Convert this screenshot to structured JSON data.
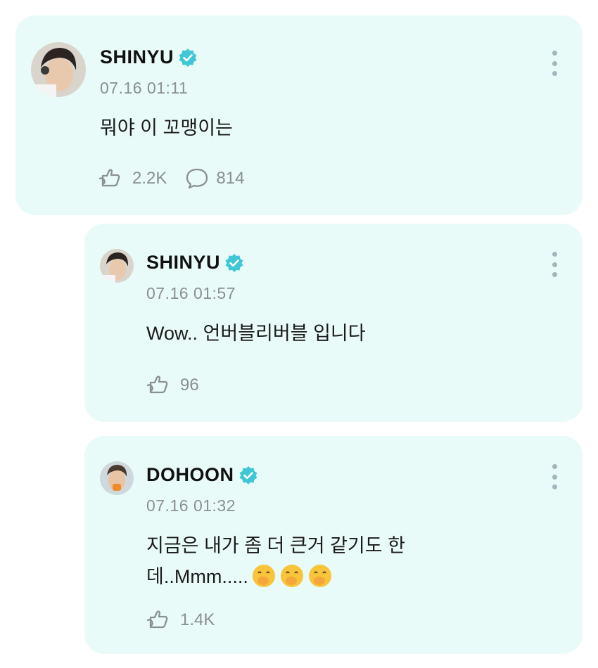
{
  "posts": [
    {
      "author": "SHINYU",
      "time": "07.16 01:11",
      "text": "뭐야 이 꼬맹이는",
      "likes": "2.2K",
      "comments": "814"
    },
    {
      "author": "SHINYU",
      "time": "07.16 01:57",
      "text": "Wow.. 언버블리버블 입니다",
      "likes": "96"
    },
    {
      "author": "DOHOON",
      "time": "07.16 01:32",
      "text_line1": "지금은 내가 좀 더 큰거 같기도 한",
      "text_line2": "데..Mmm.....",
      "likes": "1.4K"
    }
  ],
  "colors": {
    "card_bg": "#e9fbf8",
    "verified_badge": "#3fc7d6",
    "muted_text": "#8a8f93"
  },
  "icons": [
    "verified-badge-icon",
    "like-icon",
    "comment-icon",
    "more-options-icon",
    "shushing-face-emoji"
  ]
}
